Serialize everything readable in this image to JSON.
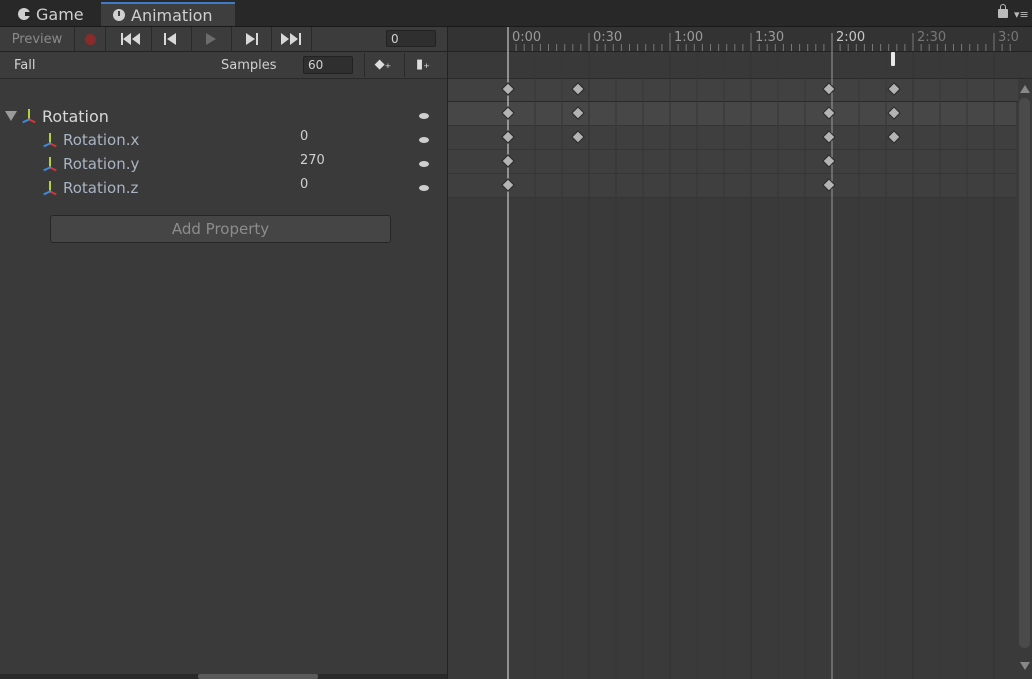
{
  "tabs": [
    {
      "label": "Game",
      "icon": "game-icon"
    },
    {
      "label": "Animation",
      "icon": "clock-icon"
    }
  ],
  "toolbar": {
    "preview_label": "Preview",
    "frame_value": "0"
  },
  "clip": {
    "name": "Fall",
    "samples_label": "Samples",
    "samples_value": "60"
  },
  "properties": {
    "group_label": "Rotation",
    "items": [
      {
        "label": "Rotation.x",
        "value": "0"
      },
      {
        "label": "Rotation.y",
        "value": "270"
      },
      {
        "label": "Rotation.z",
        "value": "0"
      }
    ],
    "add_property_label": "Add Property"
  },
  "ruler": {
    "labels": [
      "0:00",
      "0:30",
      "1:00",
      "1:30",
      "2:00",
      "2:30",
      "3:0"
    ]
  },
  "keyframes": {
    "summary": [
      0,
      17,
      80,
      96
    ],
    "group": [
      0,
      17,
      80,
      96
    ],
    "x": [
      0,
      17,
      80,
      96
    ],
    "y": [
      0,
      80
    ],
    "z": [
      0,
      80
    ]
  },
  "colors": {
    "accent_tab": "#3d7ac7",
    "record": "#8a2b2b",
    "axis_x": "#e0312f",
    "axis_y": "#b5d335",
    "axis_z": "#3a8de2"
  }
}
